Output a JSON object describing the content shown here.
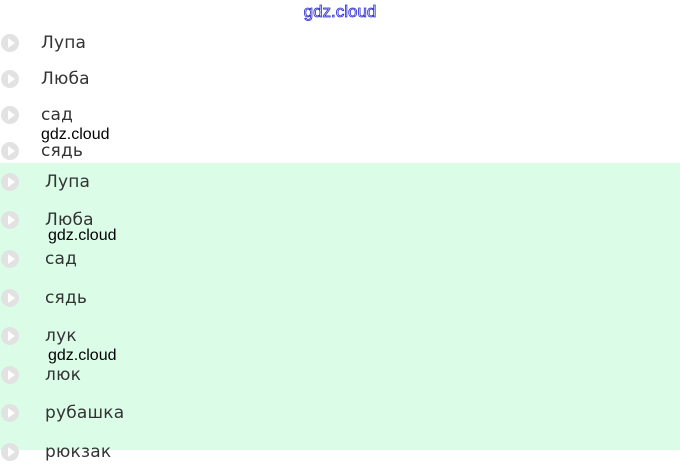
{
  "header": {
    "watermark": "gdz.cloud"
  },
  "white_list": [
    {
      "word": "Лупа"
    },
    {
      "word": "Люба"
    },
    {
      "word": "сад"
    },
    {
      "word": "сядь"
    }
  ],
  "green_list": [
    {
      "word": "Лупа"
    },
    {
      "word": "Люба"
    },
    {
      "word": "сад"
    },
    {
      "word": "сядь"
    },
    {
      "word": "лук"
    },
    {
      "word": "люк"
    },
    {
      "word": "рубашка"
    },
    {
      "word": "рюкзак"
    }
  ],
  "watermarks": [
    "gdz.cloud",
    "gdz.cloud",
    "gdz.cloud"
  ],
  "colors": {
    "green_background": "#dbfde8",
    "play_icon": "#e2e2e2",
    "word_text": "#333333"
  },
  "icons": {
    "play": "play-icon"
  }
}
